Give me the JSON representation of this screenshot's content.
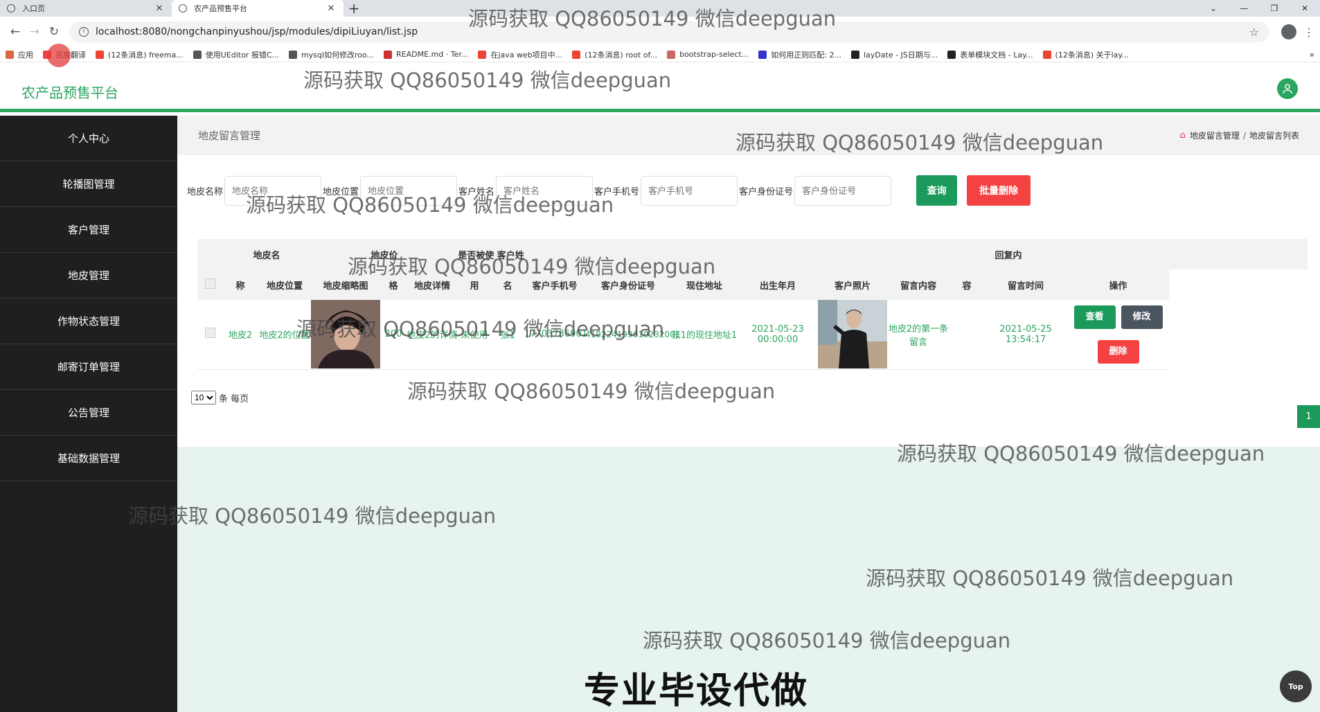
{
  "browser": {
    "tabs": [
      {
        "title": "入口页",
        "active": false
      },
      {
        "title": "农产品预售平台",
        "active": true
      }
    ],
    "new_tab": "+",
    "url": "localhost:8080/nongchanpinyushou/jsp/modules/dipiLiuyan/list.jsp",
    "bookmarks": [
      {
        "label": "应用",
        "color": "#d64"
      },
      {
        "label": "百度翻译",
        "color": "#e44"
      },
      {
        "label": "(12条消息) freema...",
        "color": "#e43"
      },
      {
        "label": "使用UEditor 报错C...",
        "color": "#555"
      },
      {
        "label": "mysql如何修改roo...",
        "color": "#555"
      },
      {
        "label": "README.md · Ter...",
        "color": "#c33"
      },
      {
        "label": "在java web项目中...",
        "color": "#e43"
      },
      {
        "label": "(12条消息) root of...",
        "color": "#e43"
      },
      {
        "label": "bootstrap-select...",
        "color": "#c66"
      },
      {
        "label": "如何用正则匹配: 2...",
        "color": "#33c"
      },
      {
        "label": "layDate - JS日期与...",
        "color": "#222"
      },
      {
        "label": "表单模块文档 - Lay...",
        "color": "#222"
      },
      {
        "label": "(12条消息) 关于lay...",
        "color": "#e43"
      }
    ]
  },
  "app": {
    "logo": "农产品预售平台",
    "accent": "#2ca561"
  },
  "sidebar": {
    "items": [
      {
        "label": "个人中心"
      },
      {
        "label": "轮播图管理"
      },
      {
        "label": "客户管理"
      },
      {
        "label": "地皮管理"
      },
      {
        "label": "作物状态管理"
      },
      {
        "label": "邮寄订单管理"
      },
      {
        "label": "公告管理"
      },
      {
        "label": "基础数据管理"
      }
    ]
  },
  "page": {
    "title": "地皮留言管理",
    "breadcrumb": [
      "地皮留言管理",
      "地皮留言列表"
    ]
  },
  "search": {
    "fields": [
      {
        "label": "地皮名称",
        "placeholder": "地皮名称"
      },
      {
        "label": "地皮位置",
        "placeholder": "地皮位置"
      },
      {
        "label": "客户姓名",
        "placeholder": "客户姓名"
      },
      {
        "label": "客户手机号",
        "placeholder": "客户手机号"
      },
      {
        "label": "客户身份证号",
        "placeholder": "客户身份证号"
      }
    ],
    "query_label": "查询",
    "batch_delete_label": "批量删除"
  },
  "table": {
    "top_headers": {
      "name": "地皮名",
      "price": "地皮价",
      "used_cust": "是否被使 客户姓",
      "reply": "回复内"
    },
    "headers": [
      "称",
      "地皮位置",
      "地皮缩略图",
      "格",
      "地皮详情",
      "用",
      "名",
      "客户手机号",
      "客户身份证号",
      "现住地址",
      "出生年月",
      "客户照片",
      "留言内容",
      "容",
      "留言时间",
      "操作"
    ],
    "rows": [
      {
        "name": "地皮2",
        "location": "地皮2的位置",
        "price": "200",
        "detail": "地皮2的详情",
        "used": "未使用",
        "cust_name": "张1",
        "phone": "17703786901",
        "id_card": "410224199610232001",
        "address": "张1的现住地址1",
        "birth": "2021-05-23 00:00:00",
        "message": "地皮2的第一条留言",
        "reply": "",
        "time": "2021-05-25 13:54:17"
      }
    ],
    "actions": {
      "view": "查看",
      "edit": "修改",
      "delete": "删除"
    }
  },
  "pager": {
    "page_size": "10",
    "per_page_label": "条 每页",
    "current_page": "1"
  },
  "to_top": "Top",
  "watermarks": {
    "text": "源码获取 QQ86050149 微信deepguan",
    "big": "专业毕设代做"
  }
}
